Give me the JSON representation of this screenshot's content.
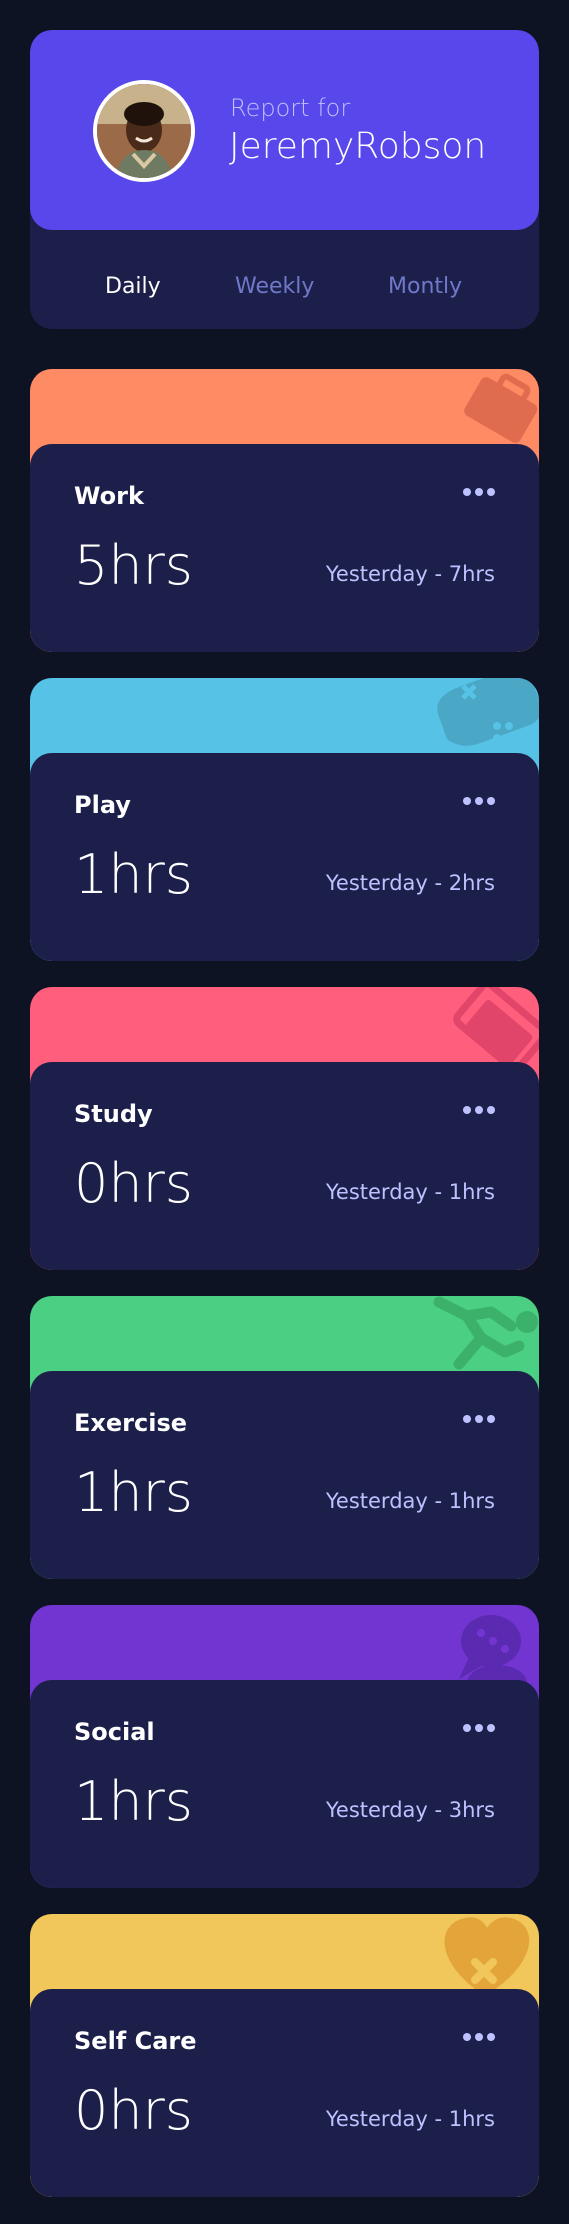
{
  "profile": {
    "report_for": "Report for",
    "name": "JeremyRobson",
    "tabs": [
      "Daily",
      "Weekly",
      "Montly"
    ],
    "active_tab": "Daily"
  },
  "activities": [
    {
      "title": "Work",
      "current": "5hrs",
      "previous": "Yesterday - 7hrs",
      "color": "#ff8b64",
      "icon": "briefcase-icon"
    },
    {
      "title": "Play",
      "current": "1hrs",
      "previous": "Yesterday - 2hrs",
      "color": "#55c2e6",
      "icon": "gamepad-icon"
    },
    {
      "title": "Study",
      "current": "0hrs",
      "previous": "Yesterday - 1hrs",
      "color": "#ff5e7d",
      "icon": "book-icon"
    },
    {
      "title": "Exercise",
      "current": "1hrs",
      "previous": "Yesterday - 1hrs",
      "color": "#4bcf82",
      "icon": "running-icon"
    },
    {
      "title": "Social",
      "current": "1hrs",
      "previous": "Yesterday - 3hrs",
      "color": "#7335d2",
      "icon": "chat-icon"
    },
    {
      "title": "Self Care",
      "current": "0hrs",
      "previous": "Yesterday - 1hrs",
      "color": "#f1c75b",
      "icon": "heart-icon"
    }
  ],
  "colors": {
    "page_bg": "#0e1323",
    "card_bg": "#1c1f4a",
    "accent": "#5847eb",
    "muted_text": "#bdc1ff",
    "inactive_tab": "#7078c9"
  }
}
